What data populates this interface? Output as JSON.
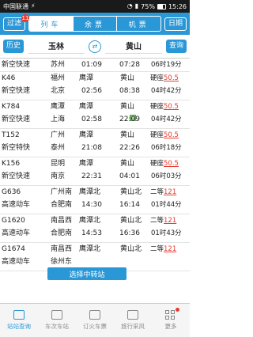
{
  "status": {
    "carrier": "中国联通",
    "battery": "75%",
    "time": "15:26"
  },
  "topbar": {
    "filter": "过滤",
    "badge": "11",
    "tabs": [
      "列车",
      "余票",
      "机票"
    ],
    "date": "日期"
  },
  "route": {
    "history": "历史",
    "from": "玉林",
    "to": "黄山",
    "query": "查询"
  },
  "trains": [
    {
      "code": "新空快速",
      "from": "苏州",
      "dep": "01:09",
      "arr": "07:28",
      "to": "",
      "info": "06时19分",
      "seat": "",
      "count": ""
    },
    {
      "code": "K46",
      "sub": "新空快速",
      "from": "福州",
      "from2": "北京",
      "dep": "02:56",
      "arr": "08:38",
      "to": "黄山",
      "to2": "04时42分",
      "seat": "硬座",
      "count": "50.5"
    },
    {
      "code": "K784",
      "sub": "新空快速",
      "from": "鹰潭",
      "from2": "上海",
      "dep": "02:58",
      "arr": "22:09",
      "to": "黄山",
      "to2": "04时42分",
      "seat": "硬座",
      "count": "50.5"
    },
    {
      "code": "T152",
      "sub": "新空特快",
      "from": "广州",
      "from2": "泰州",
      "dep": "21:08",
      "arr": "22:26",
      "to": "黄山",
      "to2": "06时18分",
      "seat": "硬座",
      "count": "50.5"
    },
    {
      "code": "K156",
      "sub": "新空快速",
      "from": "昆明",
      "from2": "南京",
      "dep": "22:31",
      "arr": "04:01",
      "to": "黄山",
      "to2": "06时03分",
      "seat": "硬座",
      "count": "50.5"
    },
    {
      "code": "G636",
      "sub": "高速动车",
      "from": "广州南",
      "from2": "合肥南",
      "dep": "14:30",
      "arr": "16:14",
      "to": "黄山北",
      "to2": "01时44分",
      "seat": "二等",
      "count": "121"
    },
    {
      "code": "G1620",
      "sub": "高速动车",
      "from": "南昌西",
      "from2": "合肥南",
      "dep": "14:53",
      "arr": "16:36",
      "to": "黄山北",
      "to2": "01时43分",
      "seat": "二等",
      "count": "121"
    },
    {
      "code": "G1674",
      "sub": "高速动车",
      "from": "南昌西",
      "from2": "徐州东",
      "dep": "",
      "arr": "",
      "to": "黄山北",
      "to2": "",
      "seat": "二等",
      "count": "121"
    }
  ],
  "transfer_button": "选择中转站",
  "tabs": [
    "站站查询",
    "车次车站",
    "订火车票",
    "旅行采风",
    "更多"
  ],
  "colors": {
    "accent": "#2a97d6",
    "price": "#e83b2e"
  }
}
